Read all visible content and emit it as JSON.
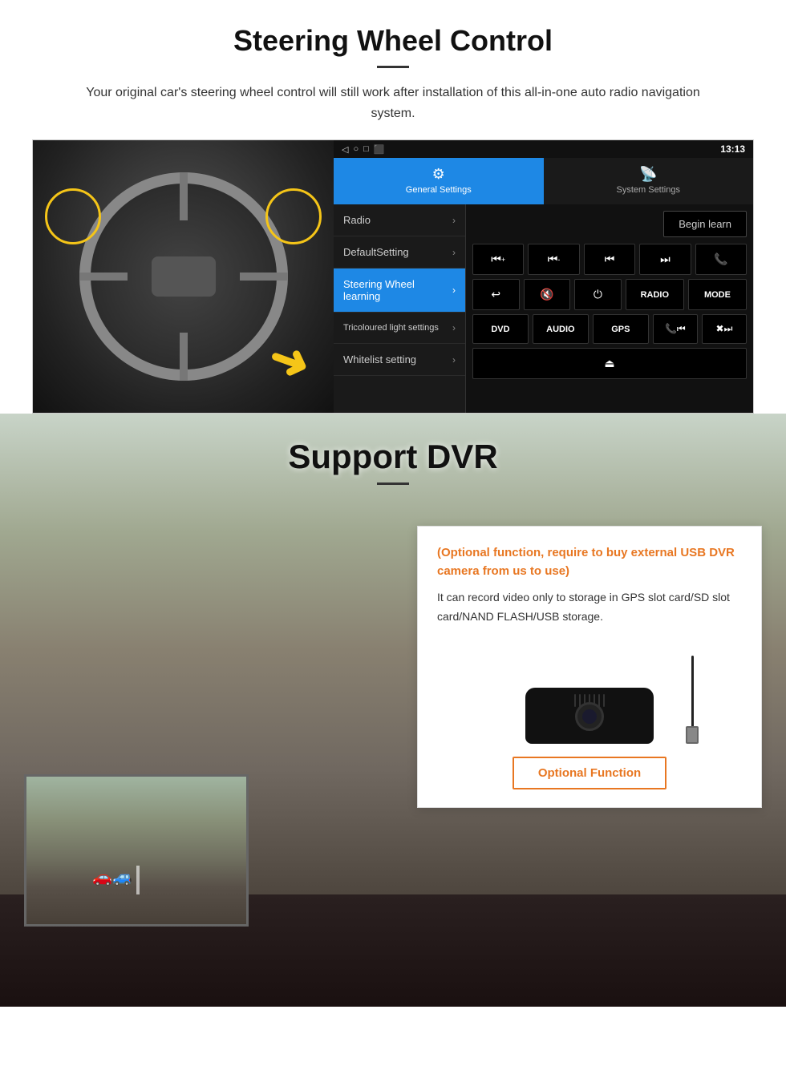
{
  "steering": {
    "title": "Steering Wheel Control",
    "subtitle": "Your original car's steering wheel control will still work after installation of this all-in-one auto radio navigation system.",
    "android": {
      "status_bar": {
        "time": "13:13",
        "nav_icons": [
          "◁",
          "○",
          "□",
          "⬛"
        ]
      },
      "tabs": [
        {
          "label": "General Settings",
          "active": true
        },
        {
          "label": "System Settings",
          "active": false
        }
      ],
      "menu_items": [
        {
          "label": "Radio",
          "active": false
        },
        {
          "label": "DefaultSetting",
          "active": false
        },
        {
          "label": "Steering Wheel learning",
          "active": true
        },
        {
          "label": "Tricoloured light settings",
          "active": false
        },
        {
          "label": "Whitelist setting",
          "active": false
        }
      ],
      "begin_learn": "Begin learn",
      "control_buttons": [
        [
          "⏮+",
          "⏮-",
          "⏮⏮",
          "⏭⏭",
          "📞"
        ],
        [
          "↩",
          "🔇x",
          "⏻",
          "RADIO",
          "MODE"
        ],
        [
          "DVD",
          "AUDIO",
          "GPS",
          "📞⏮",
          "✖⏭"
        ],
        [
          "⏏"
        ]
      ]
    }
  },
  "dvr": {
    "title": "Support DVR",
    "optional_text": "(Optional function, require to buy external USB DVR camera from us to use)",
    "desc_text": "It can record video only to storage in GPS slot card/SD slot card/NAND FLASH/USB storage.",
    "optional_button": "Optional Function"
  }
}
